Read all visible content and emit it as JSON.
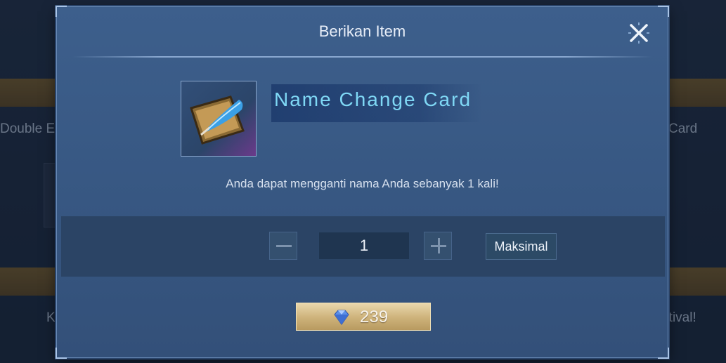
{
  "background": {
    "left_labels": [
      "Double Exp",
      "Kon"
    ],
    "right_labels": [
      "Card",
      "Festival!"
    ]
  },
  "dialog": {
    "title": "Berikan Item",
    "close_icon": "close-icon",
    "item": {
      "name": "Name Change Card",
      "icon": "quill-card-icon",
      "description": "Anda dapat mengganti nama Anda sebanyak 1 kali!"
    },
    "quantity": {
      "value": "1",
      "decrement_icon": "minus-icon",
      "increment_icon": "plus-icon",
      "max_label": "Maksimal"
    },
    "purchase": {
      "currency_icon": "diamond-icon",
      "price": "239"
    }
  },
  "colors": {
    "dialog_bg": "#3d5f8c",
    "item_name": "#7fd8f5",
    "buy_button": "#cdb27a"
  }
}
